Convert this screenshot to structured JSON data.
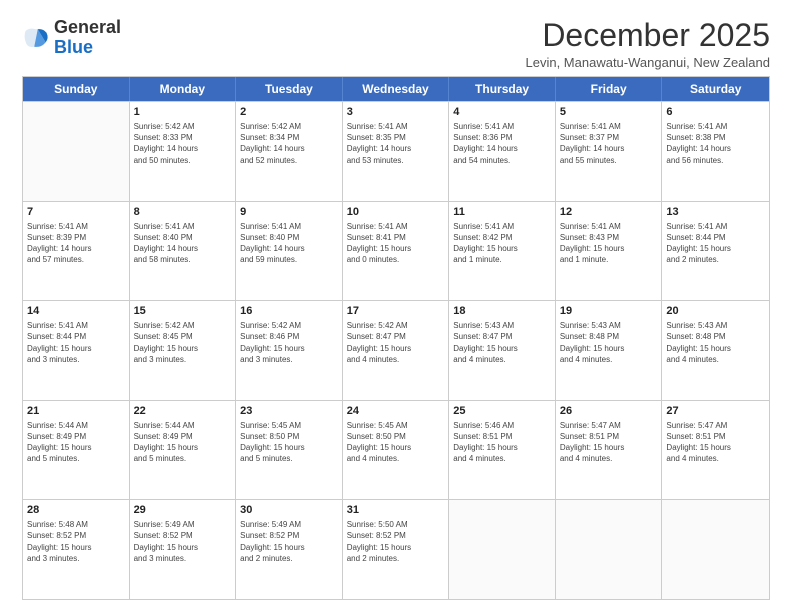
{
  "logo": {
    "line1": "General",
    "line2": "Blue"
  },
  "title": "December 2025",
  "subtitle": "Levin, Manawatu-Wanganui, New Zealand",
  "header_days": [
    "Sunday",
    "Monday",
    "Tuesday",
    "Wednesday",
    "Thursday",
    "Friday",
    "Saturday"
  ],
  "rows": [
    [
      {
        "date": "",
        "info": ""
      },
      {
        "date": "1",
        "info": "Sunrise: 5:42 AM\nSunset: 8:33 PM\nDaylight: 14 hours\nand 50 minutes."
      },
      {
        "date": "2",
        "info": "Sunrise: 5:42 AM\nSunset: 8:34 PM\nDaylight: 14 hours\nand 52 minutes."
      },
      {
        "date": "3",
        "info": "Sunrise: 5:41 AM\nSunset: 8:35 PM\nDaylight: 14 hours\nand 53 minutes."
      },
      {
        "date": "4",
        "info": "Sunrise: 5:41 AM\nSunset: 8:36 PM\nDaylight: 14 hours\nand 54 minutes."
      },
      {
        "date": "5",
        "info": "Sunrise: 5:41 AM\nSunset: 8:37 PM\nDaylight: 14 hours\nand 55 minutes."
      },
      {
        "date": "6",
        "info": "Sunrise: 5:41 AM\nSunset: 8:38 PM\nDaylight: 14 hours\nand 56 minutes."
      }
    ],
    [
      {
        "date": "7",
        "info": "Sunrise: 5:41 AM\nSunset: 8:39 PM\nDaylight: 14 hours\nand 57 minutes."
      },
      {
        "date": "8",
        "info": "Sunrise: 5:41 AM\nSunset: 8:40 PM\nDaylight: 14 hours\nand 58 minutes."
      },
      {
        "date": "9",
        "info": "Sunrise: 5:41 AM\nSunset: 8:40 PM\nDaylight: 14 hours\nand 59 minutes."
      },
      {
        "date": "10",
        "info": "Sunrise: 5:41 AM\nSunset: 8:41 PM\nDaylight: 15 hours\nand 0 minutes."
      },
      {
        "date": "11",
        "info": "Sunrise: 5:41 AM\nSunset: 8:42 PM\nDaylight: 15 hours\nand 1 minute."
      },
      {
        "date": "12",
        "info": "Sunrise: 5:41 AM\nSunset: 8:43 PM\nDaylight: 15 hours\nand 1 minute."
      },
      {
        "date": "13",
        "info": "Sunrise: 5:41 AM\nSunset: 8:44 PM\nDaylight: 15 hours\nand 2 minutes."
      }
    ],
    [
      {
        "date": "14",
        "info": "Sunrise: 5:41 AM\nSunset: 8:44 PM\nDaylight: 15 hours\nand 3 minutes."
      },
      {
        "date": "15",
        "info": "Sunrise: 5:42 AM\nSunset: 8:45 PM\nDaylight: 15 hours\nand 3 minutes."
      },
      {
        "date": "16",
        "info": "Sunrise: 5:42 AM\nSunset: 8:46 PM\nDaylight: 15 hours\nand 3 minutes."
      },
      {
        "date": "17",
        "info": "Sunrise: 5:42 AM\nSunset: 8:47 PM\nDaylight: 15 hours\nand 4 minutes."
      },
      {
        "date": "18",
        "info": "Sunrise: 5:43 AM\nSunset: 8:47 PM\nDaylight: 15 hours\nand 4 minutes."
      },
      {
        "date": "19",
        "info": "Sunrise: 5:43 AM\nSunset: 8:48 PM\nDaylight: 15 hours\nand 4 minutes."
      },
      {
        "date": "20",
        "info": "Sunrise: 5:43 AM\nSunset: 8:48 PM\nDaylight: 15 hours\nand 4 minutes."
      }
    ],
    [
      {
        "date": "21",
        "info": "Sunrise: 5:44 AM\nSunset: 8:49 PM\nDaylight: 15 hours\nand 5 minutes."
      },
      {
        "date": "22",
        "info": "Sunrise: 5:44 AM\nSunset: 8:49 PM\nDaylight: 15 hours\nand 5 minutes."
      },
      {
        "date": "23",
        "info": "Sunrise: 5:45 AM\nSunset: 8:50 PM\nDaylight: 15 hours\nand 5 minutes."
      },
      {
        "date": "24",
        "info": "Sunrise: 5:45 AM\nSunset: 8:50 PM\nDaylight: 15 hours\nand 4 minutes."
      },
      {
        "date": "25",
        "info": "Sunrise: 5:46 AM\nSunset: 8:51 PM\nDaylight: 15 hours\nand 4 minutes."
      },
      {
        "date": "26",
        "info": "Sunrise: 5:47 AM\nSunset: 8:51 PM\nDaylight: 15 hours\nand 4 minutes."
      },
      {
        "date": "27",
        "info": "Sunrise: 5:47 AM\nSunset: 8:51 PM\nDaylight: 15 hours\nand 4 minutes."
      }
    ],
    [
      {
        "date": "28",
        "info": "Sunrise: 5:48 AM\nSunset: 8:52 PM\nDaylight: 15 hours\nand 3 minutes."
      },
      {
        "date": "29",
        "info": "Sunrise: 5:49 AM\nSunset: 8:52 PM\nDaylight: 15 hours\nand 3 minutes."
      },
      {
        "date": "30",
        "info": "Sunrise: 5:49 AM\nSunset: 8:52 PM\nDaylight: 15 hours\nand 2 minutes."
      },
      {
        "date": "31",
        "info": "Sunrise: 5:50 AM\nSunset: 8:52 PM\nDaylight: 15 hours\nand 2 minutes."
      },
      {
        "date": "",
        "info": ""
      },
      {
        "date": "",
        "info": ""
      },
      {
        "date": "",
        "info": ""
      }
    ]
  ]
}
